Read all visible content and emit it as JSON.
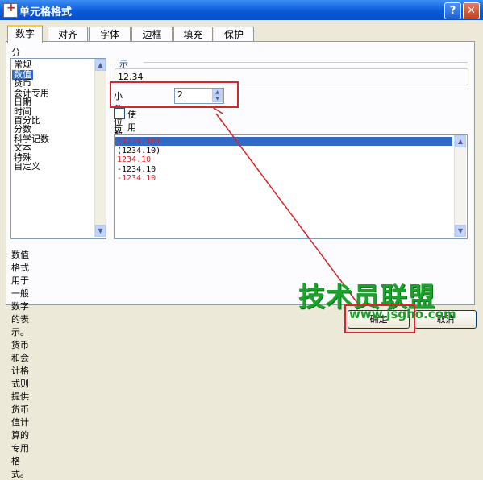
{
  "window": {
    "title": "单元格格式",
    "help_label": "?",
    "close_label": "✕"
  },
  "tabs": [
    "数字",
    "对齐",
    "字体",
    "边框",
    "填充",
    "保护"
  ],
  "category": {
    "label": "分类(C):",
    "items": [
      "常规",
      "数值",
      "货币",
      "会计专用",
      "日期",
      "时间",
      "百分比",
      "分数",
      "科学记数",
      "文本",
      "特殊",
      "自定义"
    ],
    "selected_index": 1
  },
  "sample": {
    "label": "示例",
    "value": "12.34"
  },
  "decimal": {
    "label": "小数位数(D):",
    "value": "2"
  },
  "thousand_separator": {
    "label": "使用千位分隔符(,)(U)",
    "checked": false
  },
  "negative": {
    "label": "负数(N):",
    "items": [
      {
        "text": "(1234.10)",
        "color": "#e02020",
        "selected": true
      },
      {
        "text": "(1234.10)",
        "color": "#000000",
        "selected": false
      },
      {
        "text": "1234.10",
        "color": "#e02020",
        "selected": false
      },
      {
        "text": "-1234.10",
        "color": "#000000",
        "selected": false
      },
      {
        "text": "-1234.10",
        "color": "#e02020",
        "selected": false
      }
    ]
  },
  "description": "数值格式用于一般数字的表示。货币和会计格式则提供货币值计算的专用格式。",
  "buttons": {
    "ok": "确定",
    "cancel": "取消"
  },
  "watermark": {
    "title": "技术员联盟",
    "url": "www.jsgho.com"
  },
  "colors": {
    "highlight": "#d8242a",
    "selection": "#316ac5",
    "watermark": "#1aa32b"
  }
}
